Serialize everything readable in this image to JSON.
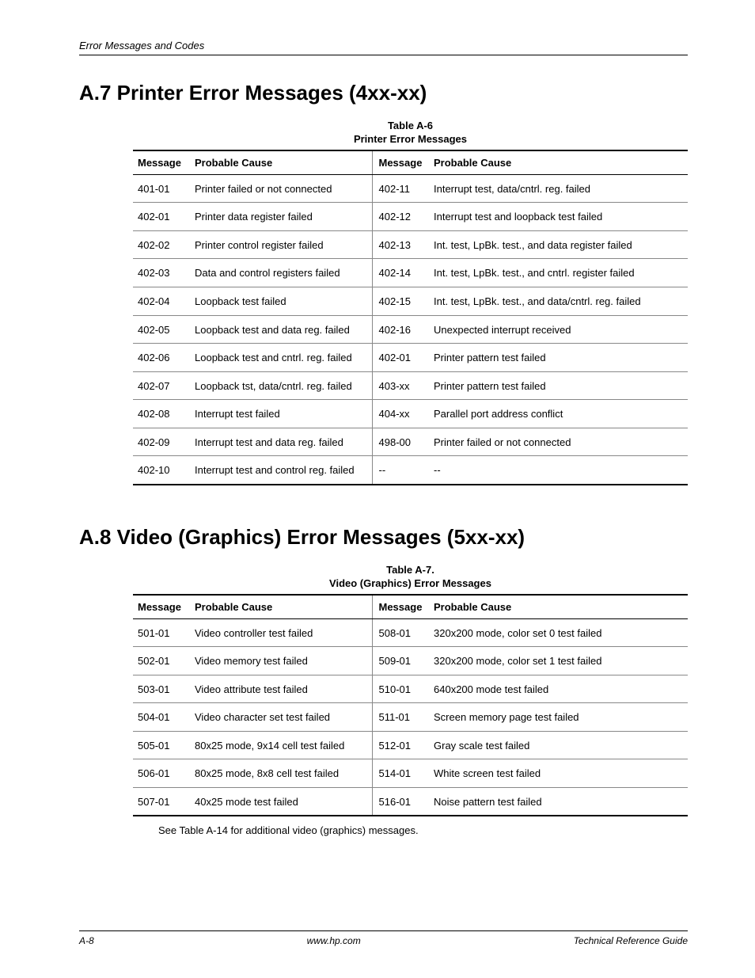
{
  "header": {
    "breadcrumb": "Error Messages and Codes"
  },
  "section1": {
    "heading": "A.7 Printer Error Messages (4xx-xx)",
    "table_num": "Table A-6",
    "table_title": "Printer Error Messages",
    "cols": {
      "c1": "Message",
      "c2": "Probable Cause",
      "c3": "Message",
      "c4": "Probable Cause"
    },
    "rows": [
      {
        "m1": "401-01",
        "p1": "Printer failed or not connected",
        "m2": "402-11",
        "p2": "Interrupt test,  data/cntrl. reg. failed"
      },
      {
        "m1": "402-01",
        "p1": "Printer data register failed",
        "m2": "402-12",
        "p2": "Interrupt test and loopback test failed"
      },
      {
        "m1": "402-02",
        "p1": "Printer control register failed",
        "m2": "402-13",
        "p2": "Int. test, LpBk. test., and data register failed"
      },
      {
        "m1": "402-03",
        "p1": "Data and control registers failed",
        "m2": "402-14",
        "p2": "Int. test, LpBk. test., and cntrl. register failed"
      },
      {
        "m1": "402-04",
        "p1": "Loopback test failed",
        "m2": "402-15",
        "p2": "Int. test, LpBk. test., and data/cntrl. reg. failed"
      },
      {
        "m1": "402-05",
        "p1": "Loopback test and data reg. failed",
        "m2": "402-16",
        "p2": "Unexpected interrupt received"
      },
      {
        "m1": "402-06",
        "p1": "Loopback test and cntrl. reg. failed",
        "m2": "402-01",
        "p2": "Printer pattern test failed"
      },
      {
        "m1": "402-07",
        "p1": "Loopback tst, data/cntrl. reg. failed",
        "m2": "403-xx",
        "p2": "Printer pattern test failed"
      },
      {
        "m1": "402-08",
        "p1": "Interrupt test failed",
        "m2": "404-xx",
        "p2": "Parallel port address conflict"
      },
      {
        "m1": "402-09",
        "p1": "Interrupt test and data reg. failed",
        "m2": "498-00",
        "p2": "Printer failed or not connected"
      },
      {
        "m1": "402-10",
        "p1": "Interrupt test and control reg. failed",
        "m2": "--",
        "p2": "--"
      }
    ]
  },
  "section2": {
    "heading": "A.8 Video (Graphics) Error Messages (5xx-xx)",
    "table_num": "Table A-7.",
    "table_title": "Video (Graphics) Error Messages",
    "cols": {
      "c1": "Message",
      "c2": "Probable Cause",
      "c3": "Message",
      "c4": "Probable Cause"
    },
    "rows": [
      {
        "m1": "501-01",
        "p1": "Video controller test failed",
        "m2": "508-01",
        "p2": "320x200 mode, color set 0 test failed"
      },
      {
        "m1": "502-01",
        "p1": "Video memory test failed",
        "m2": "509-01",
        "p2": "320x200 mode, color set 1 test failed"
      },
      {
        "m1": "503-01",
        "p1": "Video attribute test failed",
        "m2": "510-01",
        "p2": "640x200 mode test failed"
      },
      {
        "m1": "504-01",
        "p1": "Video character set test failed",
        "m2": "511-01",
        "p2": "Screen memory page test failed"
      },
      {
        "m1": "505-01",
        "p1": "80x25 mode, 9x14 cell test failed",
        "m2": "512-01",
        "p2": "Gray scale test failed"
      },
      {
        "m1": "506-01",
        "p1": "80x25 mode, 8x8 cell test failed",
        "m2": "514-01",
        "p2": "White screen test failed"
      },
      {
        "m1": "507-01",
        "p1": "40x25 mode test failed",
        "m2": "516-01",
        "p2": "Noise pattern test failed"
      }
    ],
    "note": "See Table A-14 for additional video (graphics) messages."
  },
  "footer": {
    "left": "A-8",
    "center": "www.hp.com",
    "right": "Technical Reference Guide"
  }
}
